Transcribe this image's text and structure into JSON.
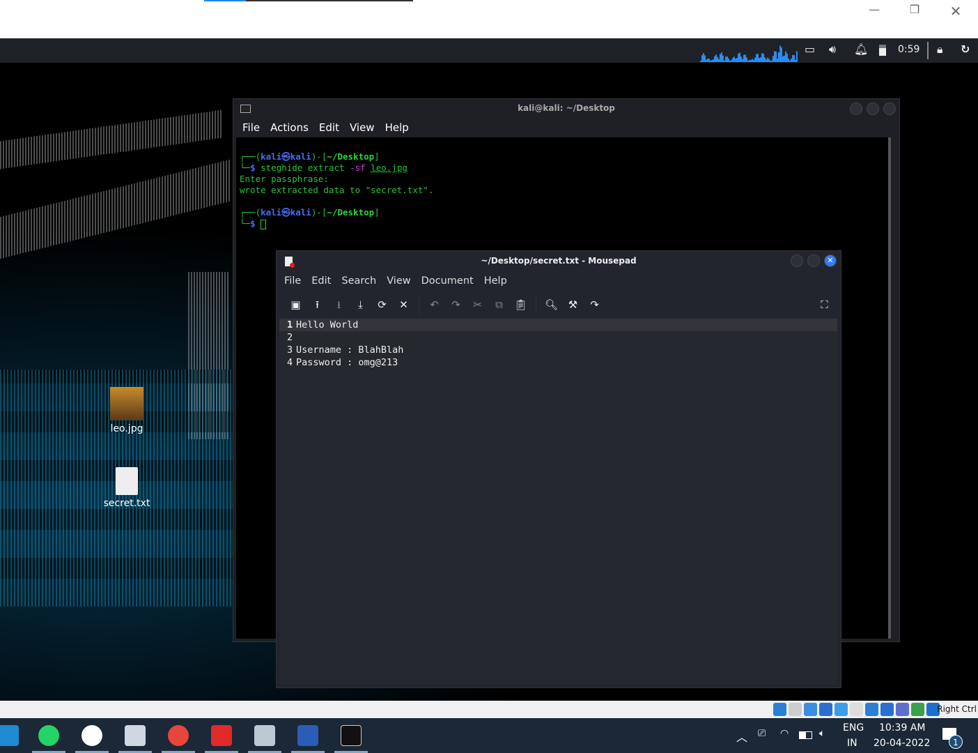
{
  "host": {
    "controls": [
      "minimize",
      "restore",
      "close"
    ]
  },
  "panel": {
    "clock": "0:59",
    "icons": [
      "network-icon",
      "volume-icon",
      "notification-icon",
      "battery-icon",
      "lock-icon",
      "logout-icon"
    ]
  },
  "desktop": {
    "icons": [
      {
        "label": "leo.jpg"
      },
      {
        "label": "secret.txt"
      }
    ]
  },
  "terminal": {
    "title": "kali@kali: ~/Desktop",
    "menu": [
      "File",
      "Actions",
      "Edit",
      "View",
      "Help"
    ],
    "user": "kali",
    "host": "kali",
    "at": "㉿",
    "cwd": "~/Desktop",
    "cmd": "steghide extract",
    "flag": "-sf",
    "arg": "leo.jpg",
    "out1": "Enter passphrase:",
    "out2": "wrote extracted data to \"secret.txt\"."
  },
  "mousepad": {
    "title": "~/Desktop/secret.txt - Mousepad",
    "menu": [
      "File",
      "Edit",
      "Search",
      "View",
      "Document",
      "Help"
    ],
    "lines": [
      {
        "n": "1",
        "t": "Hello World"
      },
      {
        "n": "2",
        "t": ""
      },
      {
        "n": "3",
        "t": "Username : BlahBlah"
      },
      {
        "n": "4",
        "t": "Password : omg@213"
      }
    ]
  },
  "vbox": {
    "hostkey": "Right Ctrl"
  },
  "taskbar": {
    "apps": [
      "vscode",
      "whatsapp",
      "edge-app",
      "virtualbox",
      "chrome",
      "app-red",
      "app-scanner",
      "word",
      "terminal"
    ],
    "lang1": "ENG",
    "lang2": "IN",
    "time": "10:39 AM",
    "date": "20-04-2022",
    "notif_count": "1"
  }
}
